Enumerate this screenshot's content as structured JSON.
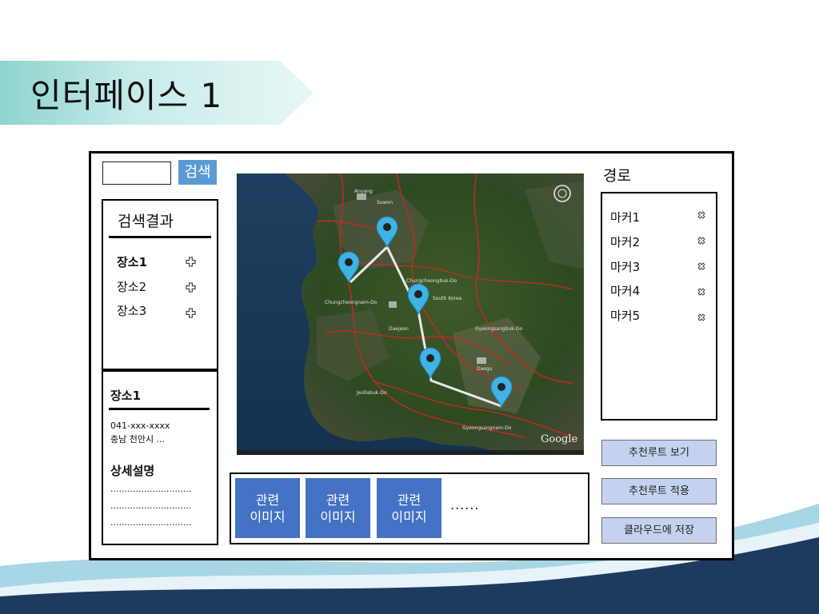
{
  "slide": {
    "title": "인터페이스 1"
  },
  "search": {
    "value": "",
    "button_label": "검색"
  },
  "results": {
    "title": "검색결과",
    "items": [
      {
        "label": "장소1",
        "bold": true
      },
      {
        "label": "장소2",
        "bold": false
      },
      {
        "label": "장소3",
        "bold": false
      }
    ]
  },
  "detail": {
    "title": "장소1",
    "phone": "041-xxx-xxxx",
    "address": "충남 천안시 ...",
    "desc_title": "상세설명",
    "desc_lines": [
      ".............................",
      ".............................",
      "............................."
    ]
  },
  "map": {
    "watermark": "Google",
    "pin_color": "#3fb2e6",
    "route_color": "#e8e8e8",
    "map_labels": [
      "Anyang",
      "Suwon",
      "Chungcheongbuk-Do",
      "Chungcheongnam-Do",
      "Daejeon",
      "South Korea",
      "Gyeongsangbuk-Do",
      "Daegu",
      "Jeollabuk-Do",
      "Gyeongsangnam-Do"
    ]
  },
  "related": {
    "images": [
      {
        "line1": "관련",
        "line2": "이미지"
      },
      {
        "line1": "관련",
        "line2": "이미지"
      },
      {
        "line1": "관련",
        "line2": "이미지"
      }
    ],
    "more": "......"
  },
  "route": {
    "title": "경로",
    "markers": [
      "마커1",
      "마커2",
      "마커3",
      "마커4",
      "마커5"
    ]
  },
  "actions": {
    "view_recommended": "추천루트 보기",
    "apply_recommended": "추천루트 적용",
    "save_cloud": "클라우드에 저장"
  },
  "colors": {
    "accent_button": "#5b9bd5",
    "related_tile": "#4472c4",
    "action_button": "#c5d2ef",
    "banner": "#8fd3ce",
    "wave_dark": "#1f3a5f",
    "wave_light": "#a9d6e5"
  }
}
